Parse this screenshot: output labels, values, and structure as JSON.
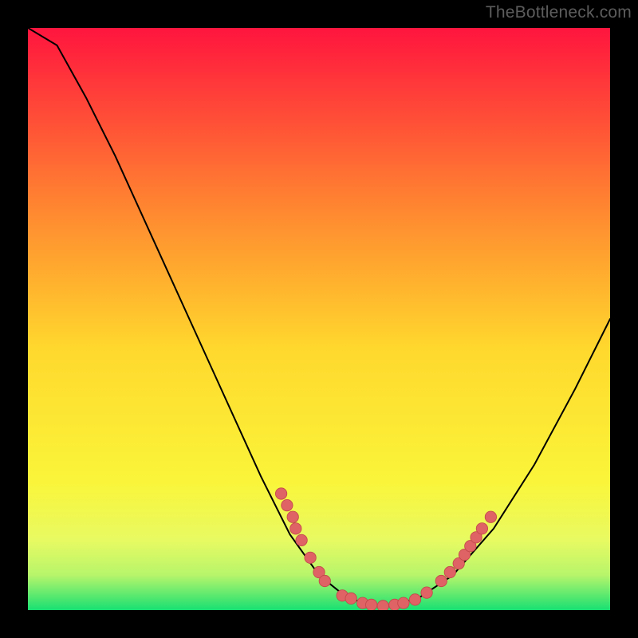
{
  "attribution": "TheBottleneck.com",
  "colors": {
    "bg": "#000000",
    "attribution": "#5c5c5c",
    "grad_top": "#ff153e",
    "grad_mid1": "#ff5a35",
    "grad_mid2": "#ffc22d",
    "grad_mid3": "#ffec2f",
    "grad_mid4": "#e9f85a",
    "grad_bot": "#18e072",
    "curve": "#000000",
    "marker_fill": "#df6265",
    "marker_stroke": "#c24749"
  },
  "chart_data": {
    "type": "line",
    "title": "",
    "xlabel": "",
    "ylabel": "",
    "xlim": [
      0,
      100
    ],
    "ylim": [
      0,
      100
    ],
    "grid": false,
    "curve": [
      {
        "x": 0,
        "y": 100
      },
      {
        "x": 5,
        "y": 97
      },
      {
        "x": 10,
        "y": 88
      },
      {
        "x": 15,
        "y": 78
      },
      {
        "x": 20,
        "y": 67
      },
      {
        "x": 25,
        "y": 56
      },
      {
        "x": 30,
        "y": 45
      },
      {
        "x": 35,
        "y": 34
      },
      {
        "x": 40,
        "y": 23
      },
      {
        "x": 45,
        "y": 13
      },
      {
        "x": 50,
        "y": 6
      },
      {
        "x": 55,
        "y": 2
      },
      {
        "x": 61,
        "y": 0.5
      },
      {
        "x": 67,
        "y": 2
      },
      {
        "x": 73,
        "y": 6
      },
      {
        "x": 80,
        "y": 14
      },
      {
        "x": 87,
        "y": 25
      },
      {
        "x": 94,
        "y": 38
      },
      {
        "x": 100,
        "y": 50
      }
    ],
    "markers_left": [
      {
        "x": 43.5,
        "y": 20.0
      },
      {
        "x": 44.5,
        "y": 18.0
      },
      {
        "x": 45.5,
        "y": 16.0
      },
      {
        "x": 46.0,
        "y": 14.0
      },
      {
        "x": 47.0,
        "y": 12.0
      },
      {
        "x": 48.5,
        "y": 9.0
      },
      {
        "x": 50.0,
        "y": 6.5
      },
      {
        "x": 51.0,
        "y": 5.0
      }
    ],
    "markers_right": [
      {
        "x": 71.0,
        "y": 5.0
      },
      {
        "x": 72.5,
        "y": 6.5
      },
      {
        "x": 74.0,
        "y": 8.0
      },
      {
        "x": 75.0,
        "y": 9.5
      },
      {
        "x": 76.0,
        "y": 11.0
      },
      {
        "x": 77.0,
        "y": 12.5
      },
      {
        "x": 78.0,
        "y": 14.0
      },
      {
        "x": 79.5,
        "y": 16.0
      }
    ],
    "markers_bottom": [
      {
        "x": 54.0,
        "y": 2.5
      },
      {
        "x": 55.5,
        "y": 2.0
      },
      {
        "x": 57.5,
        "y": 1.2
      },
      {
        "x": 59.0,
        "y": 0.9
      },
      {
        "x": 61.0,
        "y": 0.7
      },
      {
        "x": 63.0,
        "y": 0.9
      },
      {
        "x": 64.5,
        "y": 1.2
      },
      {
        "x": 66.5,
        "y": 1.8
      },
      {
        "x": 68.5,
        "y": 3.0
      }
    ]
  }
}
